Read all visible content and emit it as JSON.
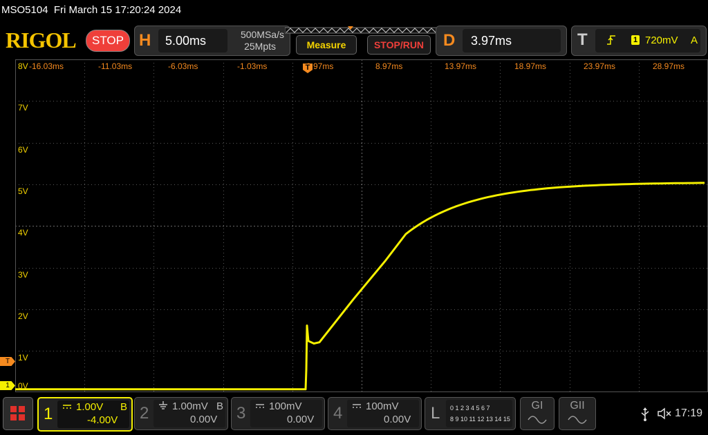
{
  "status": {
    "model": "MSO5104",
    "datetime": "Fri March 15 17:20:24 2024"
  },
  "header": {
    "brand": "RIGOL",
    "run_state": "STOP",
    "horizontal": {
      "letter": "H",
      "timebase": "5.00ms",
      "sample_rate": "500MSa/s",
      "memory_depth": "25Mpts"
    },
    "measure_label": "Measure",
    "stoprun_label": "STOP/RUN",
    "delay": {
      "letter": "D",
      "value": "3.97ms"
    },
    "trigger": {
      "letter": "T",
      "source": "1",
      "level": "720mV",
      "mode": "A"
    }
  },
  "screen": {
    "time_ticks": [
      "-16.03ms",
      "-11.03ms",
      "-6.03ms",
      "-1.03ms",
      "3.97ms",
      "8.97ms",
      "13.97ms",
      "18.97ms",
      "23.97ms",
      "28.97ms"
    ],
    "volt_ticks": [
      "8V",
      "7V",
      "6V",
      "5V",
      "4V",
      "3V",
      "2V",
      "1V",
      "0V"
    ],
    "trigger_marker": "T",
    "ch1_marker": "1",
    "trace_color": "#f5f000"
  },
  "channels": [
    {
      "num": "1",
      "scale": "1.00V",
      "offset": "-4.00V",
      "flag": "B",
      "coupling_icon": "dc-coupling-icon",
      "active": true,
      "color": "#f5f000"
    },
    {
      "num": "2",
      "scale": "1.00mV",
      "offset": "0.00V",
      "flag": "B",
      "coupling_icon": "ground-coupling-icon",
      "active": false
    },
    {
      "num": "3",
      "scale": "100mV",
      "offset": "0.00V",
      "flag": "",
      "coupling_icon": "dc-coupling-icon",
      "active": false
    },
    {
      "num": "4",
      "scale": "100mV",
      "offset": "0.00V",
      "flag": "",
      "coupling_icon": "dc-coupling-icon",
      "active": false
    }
  ],
  "logic": {
    "letter": "L",
    "row1": "0 1 2 3   4 5 6 7",
    "row2": "8 9 10 11 12 13 14 15"
  },
  "generators": [
    {
      "label": "GI"
    },
    {
      "label": "GII"
    }
  ],
  "system": {
    "time": "17:19",
    "usb_icon": "usb-icon",
    "sound_icon": "speaker-muted-icon"
  }
}
